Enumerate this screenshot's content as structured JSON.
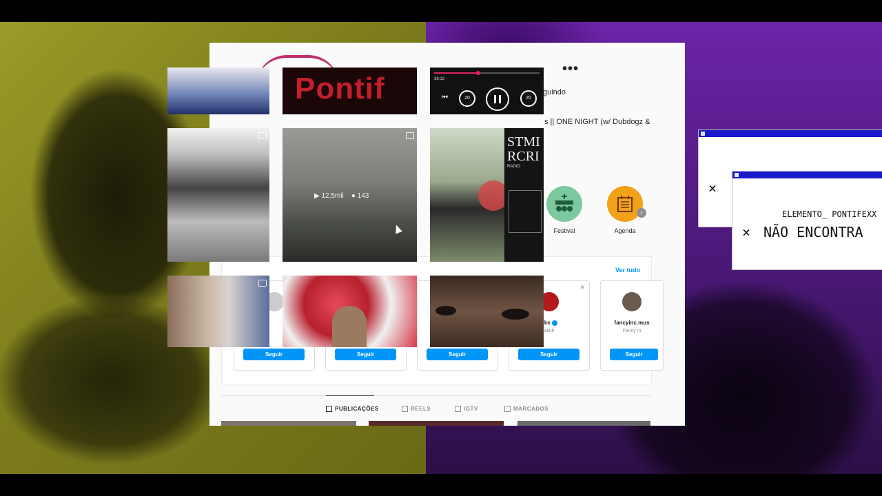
{
  "profile": {
    "following_label": "guindo",
    "bio_line": "s || ONE NIGHT (w/ Dubdogz &"
  },
  "highlights": [
    {
      "label": "Festival"
    },
    {
      "label": "Agenda"
    }
  ],
  "suggestions": {
    "see_all": "Ver tudo",
    "cards": [
      {
        "username": "",
        "subtitle": "",
        "follow": "Seguir"
      },
      {
        "username": "",
        "subtitle": "",
        "follow": "Seguir"
      },
      {
        "username": "",
        "subtitle": "",
        "follow": "Seguir"
      },
      {
        "username": "kke",
        "subtitle": "akkê",
        "follow": "Seguir",
        "verified": true
      },
      {
        "username": "fancyinc.mus",
        "subtitle": "Fancy In",
        "follow": "Seguir"
      }
    ]
  },
  "tabs": [
    {
      "label": "PUBLICAÇÕES",
      "active": true
    },
    {
      "label": "REELS"
    },
    {
      "label": "IGTV"
    },
    {
      "label": "MARCADOS"
    }
  ],
  "posts": {
    "reel_overlay": {
      "views": "12,5mil",
      "comments": "143"
    },
    "banner_text": "Pontif",
    "poster_text_1": "STMI",
    "poster_text_2": "RCRI",
    "poster_text_3": "RADIO"
  },
  "player": {
    "time": "38:13",
    "rewind": "20",
    "forward": "20",
    "progress": 0.42
  },
  "error_windows": {
    "title": "ELEMENTO_ PONTIFEXX",
    "message": "NÃO ENCONTRA",
    "close": "×"
  },
  "colors": {
    "accent": "#0095f6",
    "left_bg": "#8a8a1f",
    "right_bg": "#5a1f8f",
    "window_bar": "#1a1acc"
  }
}
